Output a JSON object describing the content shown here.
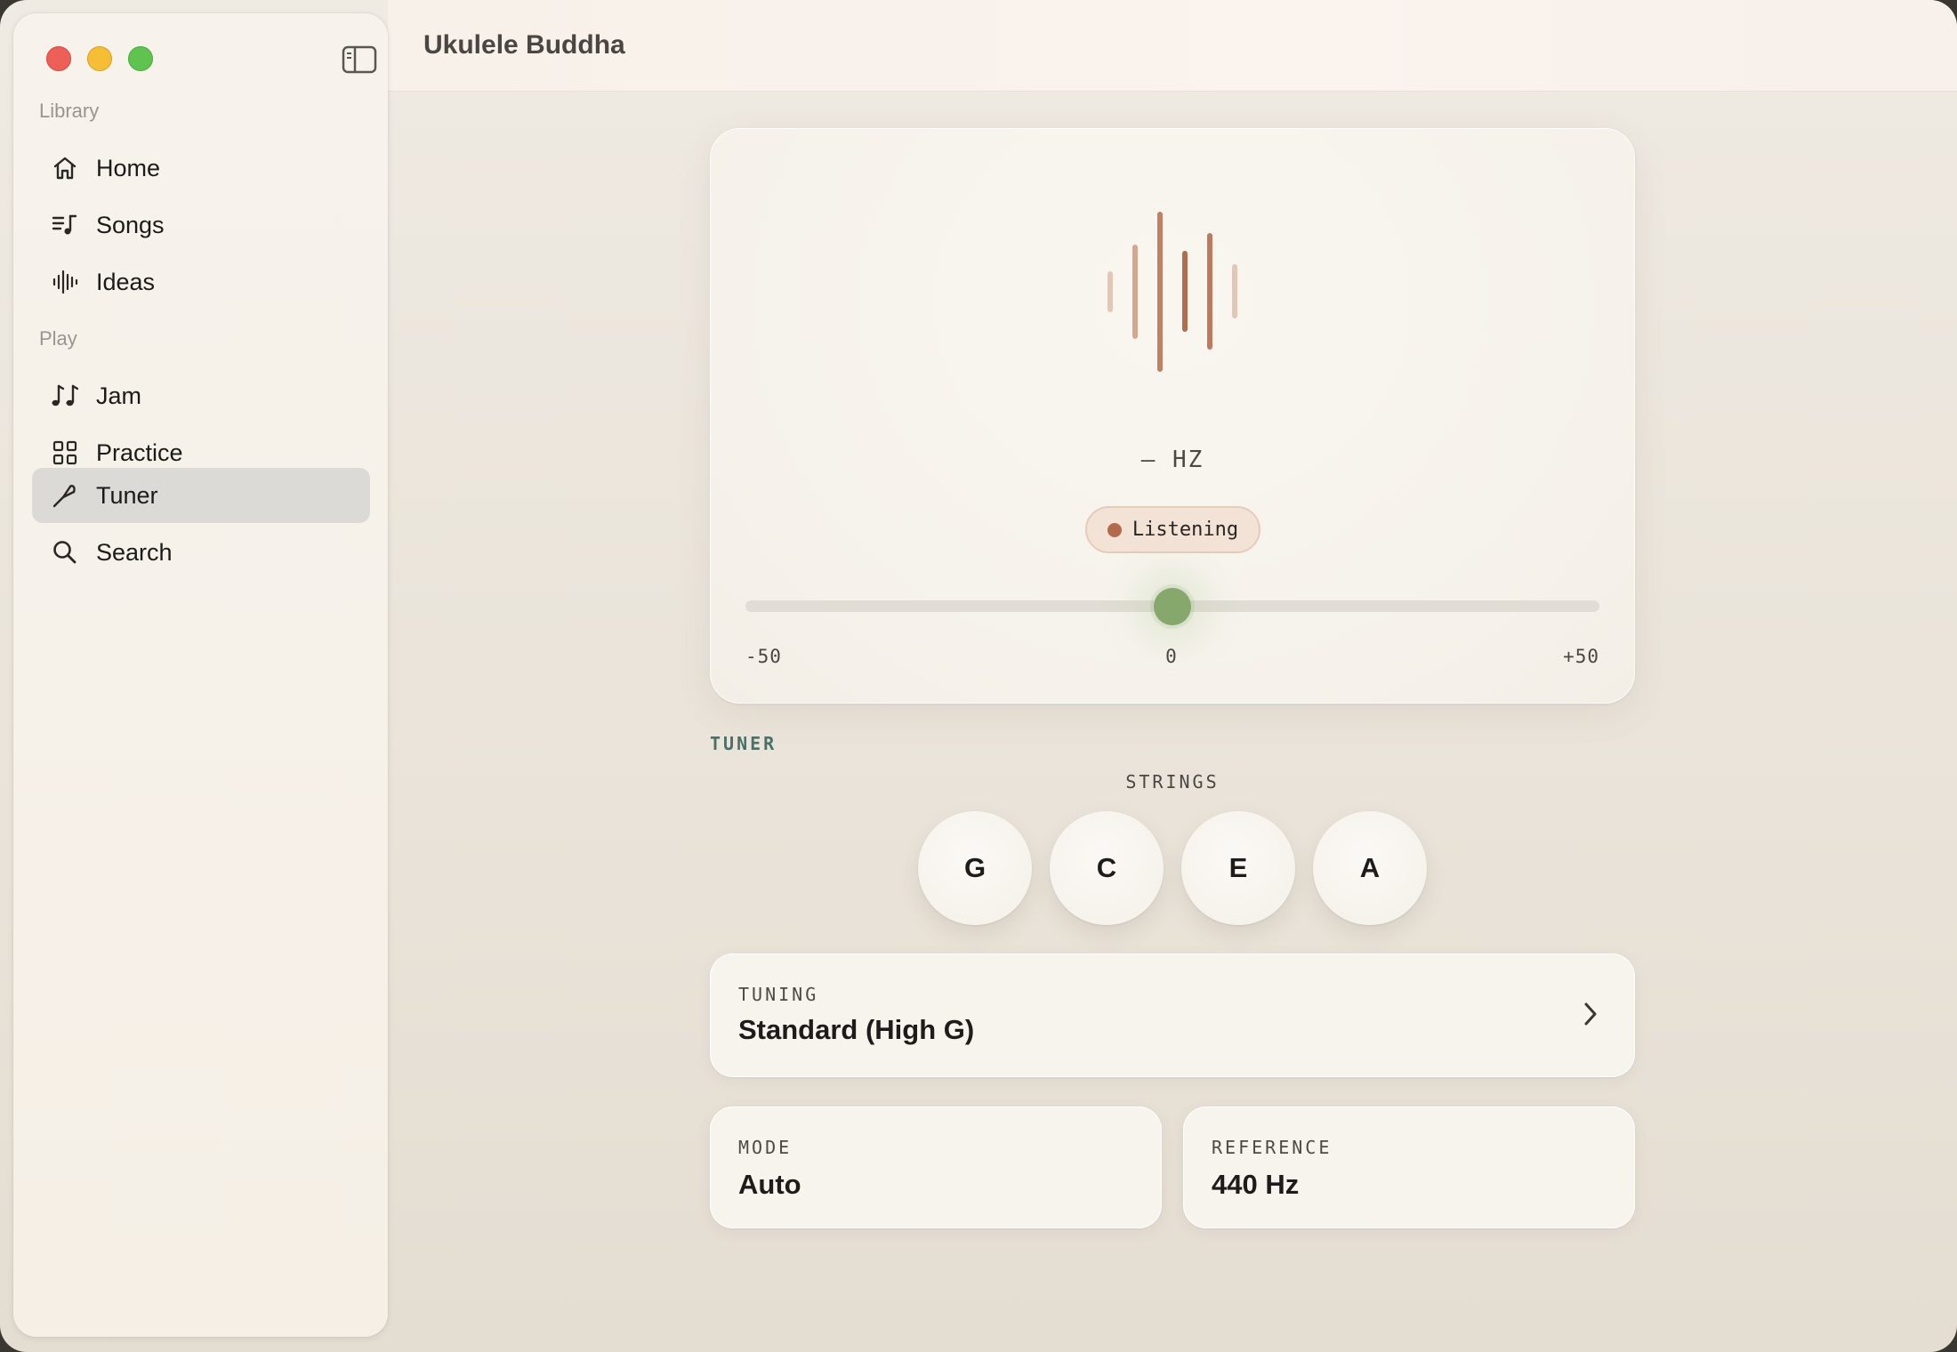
{
  "window": {
    "title": "Ukulele Buddha"
  },
  "sidebar": {
    "sections": [
      {
        "label": "Library"
      },
      {
        "label": "Play"
      }
    ],
    "items": [
      {
        "label": "Home",
        "icon": "home-icon"
      },
      {
        "label": "Songs",
        "icon": "music-list-icon"
      },
      {
        "label": "Ideas",
        "icon": "waveform-icon"
      },
      {
        "label": "Jam",
        "icon": "music-notes-icon"
      },
      {
        "label": "Practice",
        "icon": "grid-icon"
      },
      {
        "label": "Tuner",
        "icon": "tuning-fork-icon",
        "active": true
      },
      {
        "label": "Search",
        "icon": "search-icon"
      }
    ]
  },
  "tuner": {
    "frequency_text": "— HZ",
    "status": "Listening",
    "cents": {
      "min": "-50",
      "center": "0",
      "max": "+50",
      "value": 0
    },
    "section_label": "TUNER",
    "strings_label": "STRINGS",
    "strings": [
      "G",
      "C",
      "E",
      "A"
    ]
  },
  "tuning": {
    "label": "TUNING",
    "value": "Standard (High G)"
  },
  "mode": {
    "label": "MODE",
    "value": "Auto"
  },
  "reference": {
    "label": "REFERENCE",
    "value": "440 Hz"
  },
  "colors": {
    "accent_green": "#86a86c",
    "accent_copper": "#b36a4c",
    "section_teal": "#4d6f6a"
  }
}
